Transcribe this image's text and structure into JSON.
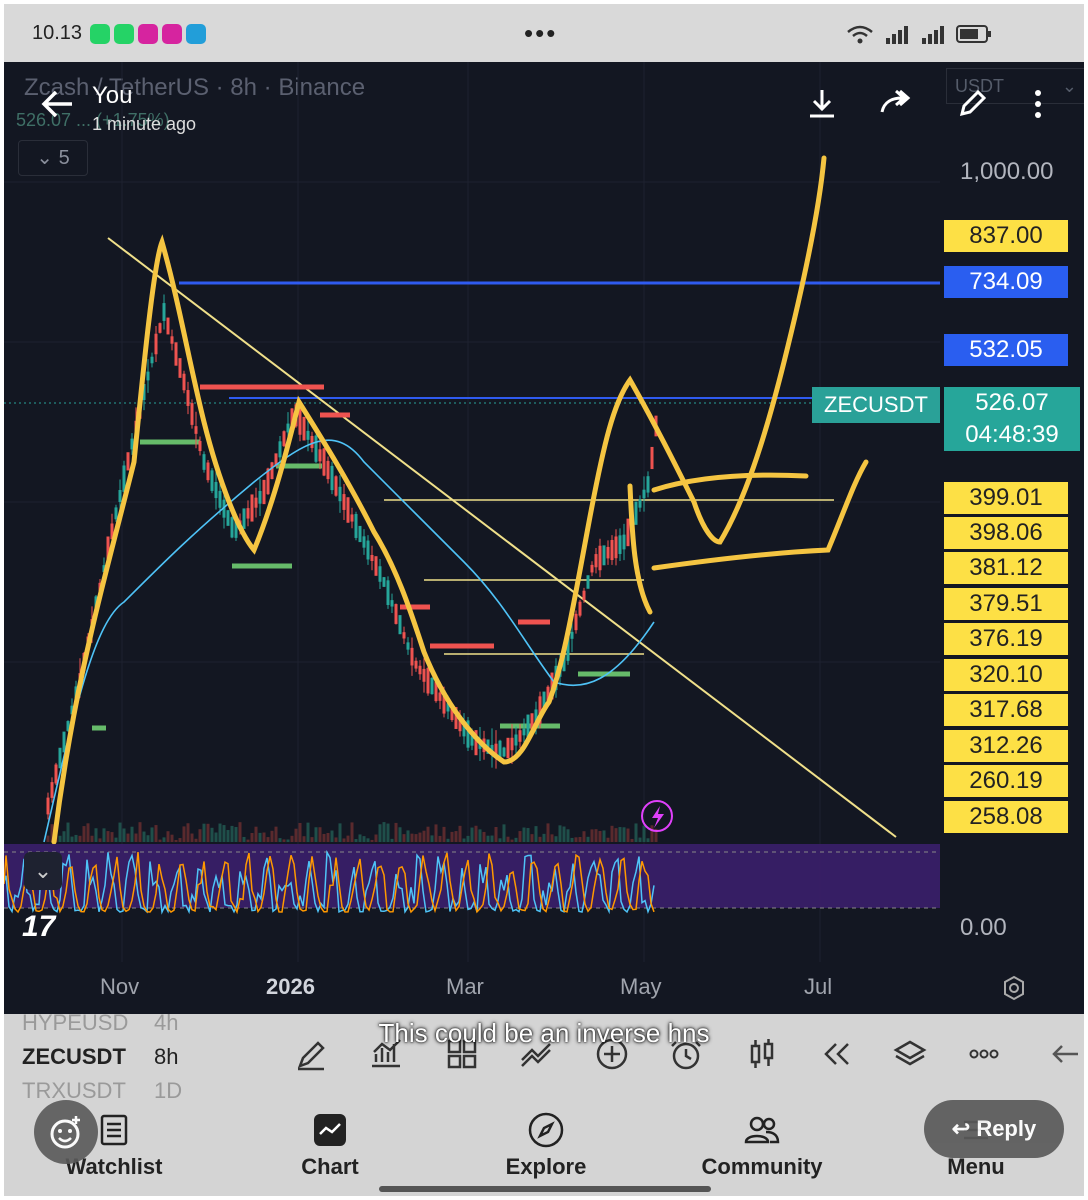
{
  "status": {
    "time": "10.13",
    "dots": "•••",
    "app_icons": [
      "whatsapp-icon",
      "whatsapp-business-icon",
      "instagram-icon",
      "instagram-icon",
      "telegram-icon"
    ]
  },
  "whatsapp": {
    "sender": "You",
    "time": "1 minute ago",
    "caption": "This could be an inverse hns",
    "reply_label": "Reply"
  },
  "chart_header": {
    "title": "Zcash / TetherUS · 8h · Binance",
    "price_change": "526.07 ... (+1.75%)",
    "interval_count": "5",
    "currency": "USDT"
  },
  "price_axis": {
    "top_label": "1,000.00",
    "bottom_label": "0.00",
    "labels": [
      {
        "value": "837.00",
        "style": "yellow"
      },
      {
        "value": "734.09",
        "style": "blue"
      },
      {
        "value": "532.05",
        "style": "blue"
      },
      {
        "value": "399.01",
        "style": "yellow"
      },
      {
        "value": "398.06",
        "style": "yellow"
      },
      {
        "value": "381.12",
        "style": "yellow"
      },
      {
        "value": "379.51",
        "style": "yellow"
      },
      {
        "value": "376.19",
        "style": "yellow"
      },
      {
        "value": "320.10",
        "style": "yellow"
      },
      {
        "value": "317.68",
        "style": "yellow"
      },
      {
        "value": "312.26",
        "style": "yellow"
      },
      {
        "value": "260.19",
        "style": "yellow"
      },
      {
        "value": "258.08",
        "style": "yellow"
      }
    ],
    "current": {
      "symbol": "ZECUSDT",
      "price": "526.07",
      "countdown": "04:48:39"
    }
  },
  "time_axis": [
    "Nov",
    "2026",
    "Mar",
    "May",
    "Jul"
  ],
  "watchlist": [
    {
      "symbol": "HYPEUSD",
      "interval": "4h",
      "ghost": true
    },
    {
      "symbol": "ZECUSDT",
      "interval": "8h",
      "ghost": false
    },
    {
      "symbol": "TRXUSDT",
      "interval": "1D",
      "ghost": true
    }
  ],
  "bottom_nav": [
    {
      "label": "Watchlist",
      "icon": "watchlist-icon"
    },
    {
      "label": "Chart",
      "icon": "chart-icon"
    },
    {
      "label": "Explore",
      "icon": "compass-icon"
    },
    {
      "label": "Community",
      "icon": "community-icon"
    },
    {
      "label": "Menu",
      "icon": "menu-icon"
    }
  ],
  "colors": {
    "background": "#131722",
    "yellow_label": "#fde045",
    "blue_label": "#2a5ef0",
    "teal": "#26a69a",
    "drawing": "#f5c542",
    "oscillator_band": "#3b1f6b"
  }
}
